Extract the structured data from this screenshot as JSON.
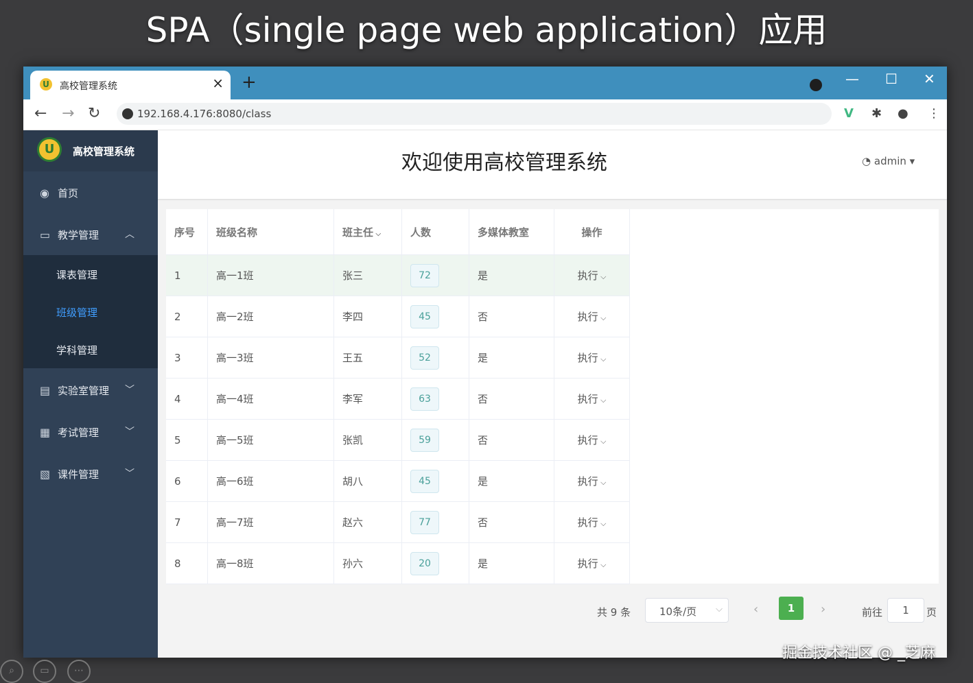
{
  "slide": {
    "title": "SPA（single page web application）应用"
  },
  "browser": {
    "tab_title": "高校管理系统",
    "tab_close": "×",
    "new_tab": "+",
    "url": "192.168.4.176:8080/class",
    "win_min": "—",
    "win_max": "☐",
    "win_close": "✕"
  },
  "sidebar": {
    "logo_text": "高校管理系统",
    "items": [
      {
        "label": "首页",
        "icon": "dashboard-icon"
      },
      {
        "label": "教学管理",
        "icon": "monitor-icon",
        "expanded": true
      },
      {
        "label": "实验室管理",
        "icon": "lab-doc-icon"
      },
      {
        "label": "考试管理",
        "icon": "exam-icon"
      },
      {
        "label": "课件管理",
        "icon": "courseware-icon"
      }
    ],
    "subitems": [
      {
        "label": "课表管理"
      },
      {
        "label": "班级管理",
        "active": true
      },
      {
        "label": "学科管理"
      }
    ]
  },
  "header": {
    "title": "欢迎使用高校管理系统",
    "user": "admin"
  },
  "table": {
    "columns": [
      "序号",
      "班级名称",
      "班主任",
      "人数",
      "多媒体教室",
      "操作"
    ],
    "rows": [
      [
        "1",
        "高一1班",
        "张三",
        "72",
        "是",
        "执行"
      ],
      [
        "2",
        "高一2班",
        "李四",
        "45",
        "否",
        "执行"
      ],
      [
        "3",
        "高一3班",
        "王五",
        "52",
        "是",
        "执行"
      ],
      [
        "4",
        "高一4班",
        "李军",
        "63",
        "否",
        "执行"
      ],
      [
        "5",
        "高一5班",
        "张凯",
        "59",
        "否",
        "执行"
      ],
      [
        "6",
        "高一6班",
        "胡八",
        "45",
        "是",
        "执行"
      ],
      [
        "7",
        "高一7班",
        "赵六",
        "77",
        "否",
        "执行"
      ],
      [
        "8",
        "高一8班",
        "孙六",
        "20",
        "是",
        "执行"
      ]
    ]
  },
  "pager": {
    "total": "共 9 条",
    "page_size": "10条/页",
    "current": "1",
    "goto_label": "前往",
    "goto_value": "1",
    "page_suffix": "页"
  },
  "watermark": "掘金技术社区 @ _芝麻",
  "colors": {
    "tabbar": "#3f8fbd",
    "sidebar": "#304156",
    "active_menu": "#409eff",
    "pager_active": "#4caf50"
  }
}
